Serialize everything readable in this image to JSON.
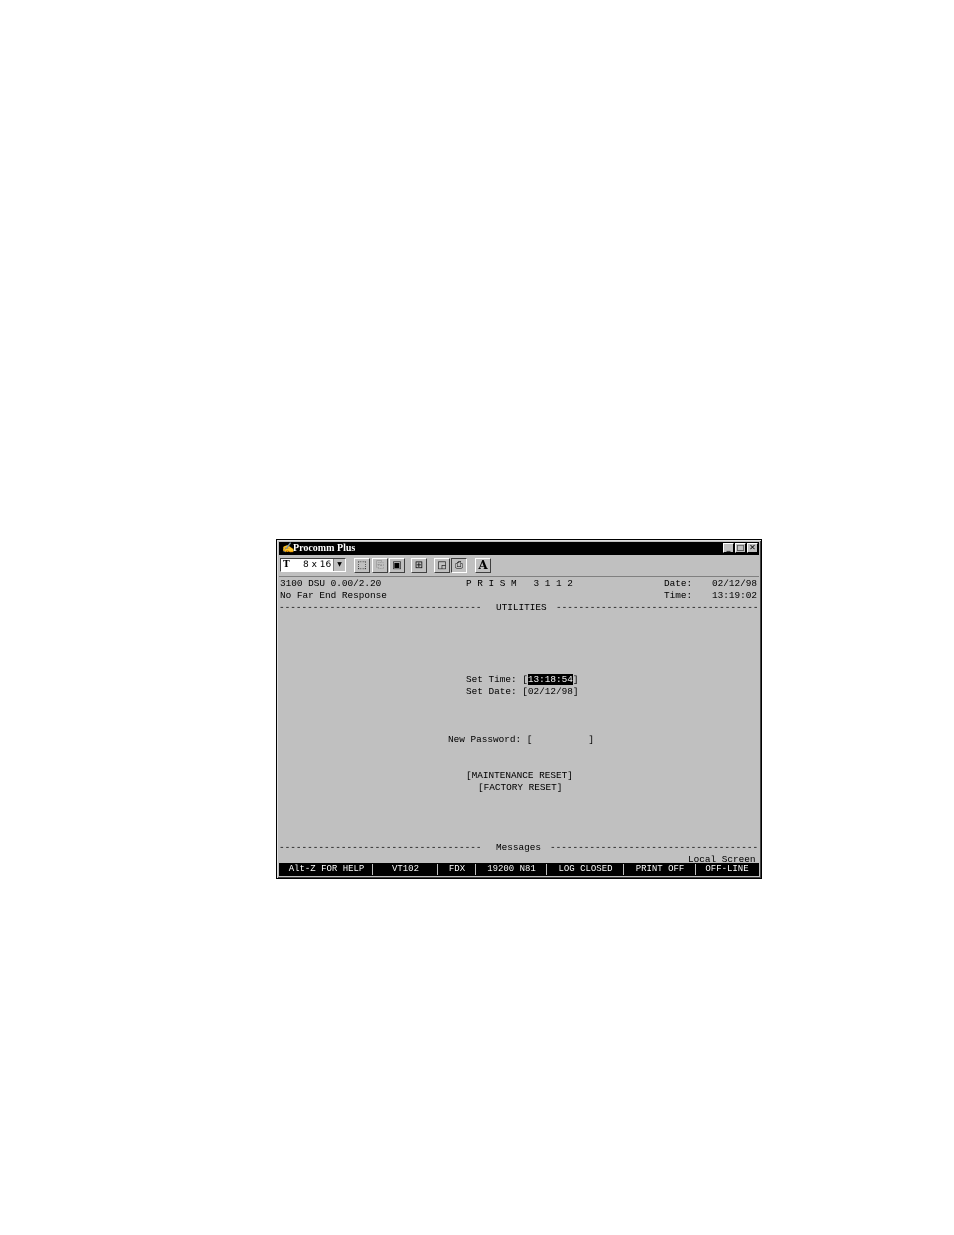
{
  "window": {
    "title": "Procomm Plus",
    "controls": {
      "minimize": "_",
      "maximize": "□",
      "close": "✕"
    }
  },
  "toolbar": {
    "font_size": "8 x 16",
    "font_icon": "T"
  },
  "terminal": {
    "header_left_1": "3100 DSU 0.00/2.20",
    "product": "P R I S M   3 1 1 2",
    "date_label": "Date:",
    "date_value": "02/12/98",
    "header_left_2": "No Far End Response",
    "time_label": "Time:",
    "time_value": "13:19:02",
    "section_title": "UTILITIES",
    "set_time_label": "Set Time:",
    "set_time_value": "13:18:54",
    "set_date_label": "Set Date:",
    "set_date_value": "02/12/98",
    "password_label": "New Password:",
    "password_value": "",
    "maintenance_reset": "MAINTENANCE RESET",
    "factory_reset": "FACTORY RESET",
    "messages_title": "Messages",
    "screen_mode": "Local Screen"
  },
  "status_bar": {
    "help": "Alt-Z FOR HELP",
    "emulation": "VT102",
    "duplex": "FDX",
    "port": "19200 N81",
    "log": "LOG CLOSED",
    "print": "PRINT OFF",
    "line": "OFF-LINE"
  }
}
